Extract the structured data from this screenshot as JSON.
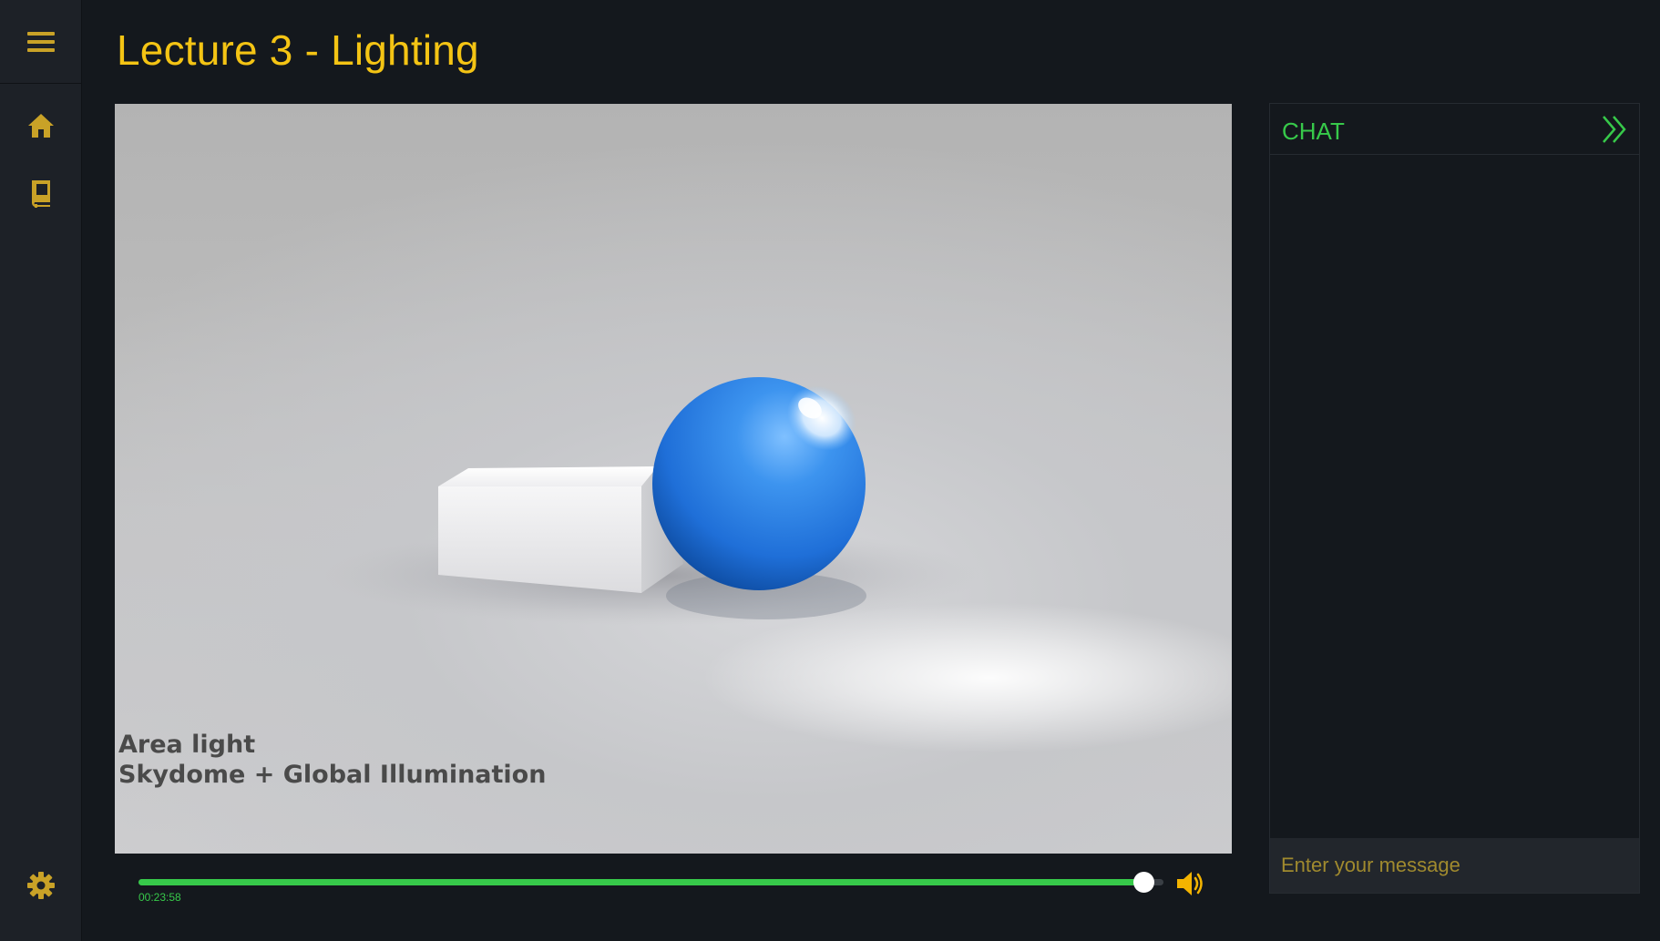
{
  "page": {
    "title": "Lecture 3 - Lighting"
  },
  "sidebar": {
    "menu_icon": "hamburger-menu-icon",
    "items": [
      {
        "name": "home",
        "icon": "home-icon"
      },
      {
        "name": "book",
        "icon": "book-icon"
      }
    ],
    "settings_icon": "gear-icon",
    "icon_color": "#c9a227"
  },
  "video": {
    "caption_lines": [
      "Area light",
      "Skydome + Global Illumination"
    ],
    "time": "00:23:58",
    "progress": 0.98,
    "volume_icon": "volume-icon",
    "accent": "#37c94a"
  },
  "chat": {
    "title": "CHAT",
    "collapse_icon": "double-chevron-right-icon",
    "input_placeholder": "Enter your message",
    "accent": "#37c94a"
  }
}
